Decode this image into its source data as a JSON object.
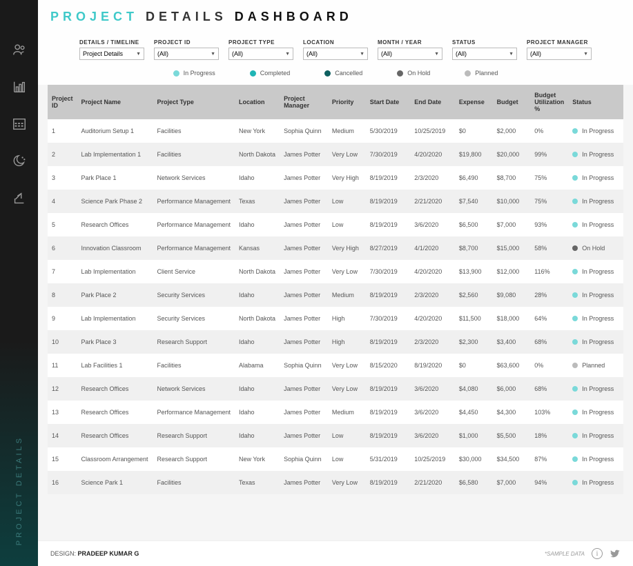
{
  "title": {
    "p1": "PROJECT",
    "p2": "DETAILS",
    "p3": "DASHBOARD"
  },
  "verticalLabel": "PROJECT DETAILS",
  "filters": [
    {
      "label": "DETAILS / TIMELINE",
      "value": "Project Details"
    },
    {
      "label": "PROJECT ID",
      "value": "(All)"
    },
    {
      "label": "PROJECT TYPE",
      "value": "(All)"
    },
    {
      "label": "LOCATION",
      "value": "(All)"
    },
    {
      "label": "MONTH / YEAR",
      "value": "(All)"
    },
    {
      "label": "STATUS",
      "value": "(All)"
    },
    {
      "label": "PROJECT MANAGER",
      "value": "(All)"
    }
  ],
  "legend": [
    {
      "label": "In Progress",
      "cls": "inprogress"
    },
    {
      "label": "Completed",
      "cls": "completed"
    },
    {
      "label": "Cancelled",
      "cls": "cancelled"
    },
    {
      "label": "On Hold",
      "cls": "onhold"
    },
    {
      "label": "Planned",
      "cls": "planned"
    }
  ],
  "columns": [
    "Project ID",
    "Project Name",
    "Project Type",
    "Location",
    "Project Manager",
    "Priority",
    "Start Date",
    "End Date",
    "Expense",
    "Budget",
    "Budget Utilization %",
    "Status"
  ],
  "rows": [
    {
      "id": "1",
      "name": "Auditorium Setup 1",
      "type": "Facilities",
      "loc": "New York",
      "pm": "Sophia Quinn",
      "pri": "Medium",
      "start": "5/30/2019",
      "end": "10/25/2019",
      "exp": "$0",
      "bud": "$2,000",
      "util": "0%",
      "status": "In Progress",
      "scls": "inprogress"
    },
    {
      "id": "2",
      "name": "Lab Implementation 1",
      "type": "Facilities",
      "loc": "North Dakota",
      "pm": "James Potter",
      "pri": "Very Low",
      "start": "7/30/2019",
      "end": "4/20/2020",
      "exp": "$19,800",
      "bud": "$20,000",
      "util": "99%",
      "status": "In Progress",
      "scls": "inprogress"
    },
    {
      "id": "3",
      "name": "Park Place 1",
      "type": "Network Services",
      "loc": "Idaho",
      "pm": "James Potter",
      "pri": "Very High",
      "start": "8/19/2019",
      "end": "2/3/2020",
      "exp": "$6,490",
      "bud": "$8,700",
      "util": "75%",
      "status": "In Progress",
      "scls": "inprogress"
    },
    {
      "id": "4",
      "name": "Science Park Phase 2",
      "type": "Performance Management",
      "loc": "Texas",
      "pm": "James Potter",
      "pri": "Low",
      "start": "8/19/2019",
      "end": "2/21/2020",
      "exp": "$7,540",
      "bud": "$10,000",
      "util": "75%",
      "status": "In Progress",
      "scls": "inprogress"
    },
    {
      "id": "5",
      "name": "Research Offices",
      "type": "Performance Management",
      "loc": "Idaho",
      "pm": "James Potter",
      "pri": "Low",
      "start": "8/19/2019",
      "end": "3/6/2020",
      "exp": "$6,500",
      "bud": "$7,000",
      "util": "93%",
      "status": "In Progress",
      "scls": "inprogress"
    },
    {
      "id": "6",
      "name": "Innovation Classroom",
      "type": "Performance Management",
      "loc": "Kansas",
      "pm": "James Potter",
      "pri": "Very High",
      "start": "8/27/2019",
      "end": "4/1/2020",
      "exp": "$8,700",
      "bud": "$15,000",
      "util": "58%",
      "status": "On Hold",
      "scls": "onhold"
    },
    {
      "id": "7",
      "name": "Lab Implementation",
      "type": "Client Service",
      "loc": "North Dakota",
      "pm": "James Potter",
      "pri": "Very Low",
      "start": "7/30/2019",
      "end": "4/20/2020",
      "exp": "$13,900",
      "bud": "$12,000",
      "util": "116%",
      "status": "In Progress",
      "scls": "inprogress"
    },
    {
      "id": "8",
      "name": "Park Place 2",
      "type": "Security Services",
      "loc": "Idaho",
      "pm": "James Potter",
      "pri": "Medium",
      "start": "8/19/2019",
      "end": "2/3/2020",
      "exp": "$2,560",
      "bud": "$9,080",
      "util": "28%",
      "status": "In Progress",
      "scls": "inprogress"
    },
    {
      "id": "9",
      "name": "Lab Implementation",
      "type": "Security Services",
      "loc": "North Dakota",
      "pm": "James Potter",
      "pri": "High",
      "start": "7/30/2019",
      "end": "4/20/2020",
      "exp": "$11,500",
      "bud": "$18,000",
      "util": "64%",
      "status": "In Progress",
      "scls": "inprogress"
    },
    {
      "id": "10",
      "name": "Park Place 3",
      "type": "Research Support",
      "loc": "Idaho",
      "pm": "James Potter",
      "pri": "High",
      "start": "8/19/2019",
      "end": "2/3/2020",
      "exp": "$2,300",
      "bud": "$3,400",
      "util": "68%",
      "status": "In Progress",
      "scls": "inprogress"
    },
    {
      "id": "11",
      "name": "Lab Facilities 1",
      "type": "Facilities",
      "loc": "Alabama",
      "pm": "Sophia Quinn",
      "pri": "Very Low",
      "start": "8/15/2020",
      "end": "8/19/2020",
      "exp": "$0",
      "bud": "$63,600",
      "util": "0%",
      "status": "Planned",
      "scls": "planned"
    },
    {
      "id": "12",
      "name": "Research Offices",
      "type": "Network Services",
      "loc": "Idaho",
      "pm": "James Potter",
      "pri": "Very Low",
      "start": "8/19/2019",
      "end": "3/6/2020",
      "exp": "$4,080",
      "bud": "$6,000",
      "util": "68%",
      "status": "In Progress",
      "scls": "inprogress"
    },
    {
      "id": "13",
      "name": "Research Offices",
      "type": "Performance Management",
      "loc": "Idaho",
      "pm": "James Potter",
      "pri": "Medium",
      "start": "8/19/2019",
      "end": "3/6/2020",
      "exp": "$4,450",
      "bud": "$4,300",
      "util": "103%",
      "status": "In Progress",
      "scls": "inprogress"
    },
    {
      "id": "14",
      "name": "Research Offices",
      "type": "Research Support",
      "loc": "Idaho",
      "pm": "James Potter",
      "pri": "Low",
      "start": "8/19/2019",
      "end": "3/6/2020",
      "exp": "$1,000",
      "bud": "$5,500",
      "util": "18%",
      "status": "In Progress",
      "scls": "inprogress"
    },
    {
      "id": "15",
      "name": "Classroom Arrangement",
      "type": "Research Support",
      "loc": "New York",
      "pm": "Sophia Quinn",
      "pri": "Low",
      "start": "5/31/2019",
      "end": "10/25/2019",
      "exp": "$30,000",
      "bud": "$34,500",
      "util": "87%",
      "status": "In Progress",
      "scls": "inprogress"
    },
    {
      "id": "16",
      "name": "Science Park 1",
      "type": "Facilities",
      "loc": "Texas",
      "pm": "James Potter",
      "pri": "Very Low",
      "start": "8/19/2019",
      "end": "2/21/2020",
      "exp": "$6,580",
      "bud": "$7,000",
      "util": "94%",
      "status": "In Progress",
      "scls": "inprogress"
    }
  ],
  "footer": {
    "designLabel": "DESIGN:",
    "designer": "PRADEEP KUMAR G",
    "sample": "*SAMPLE DATA"
  }
}
